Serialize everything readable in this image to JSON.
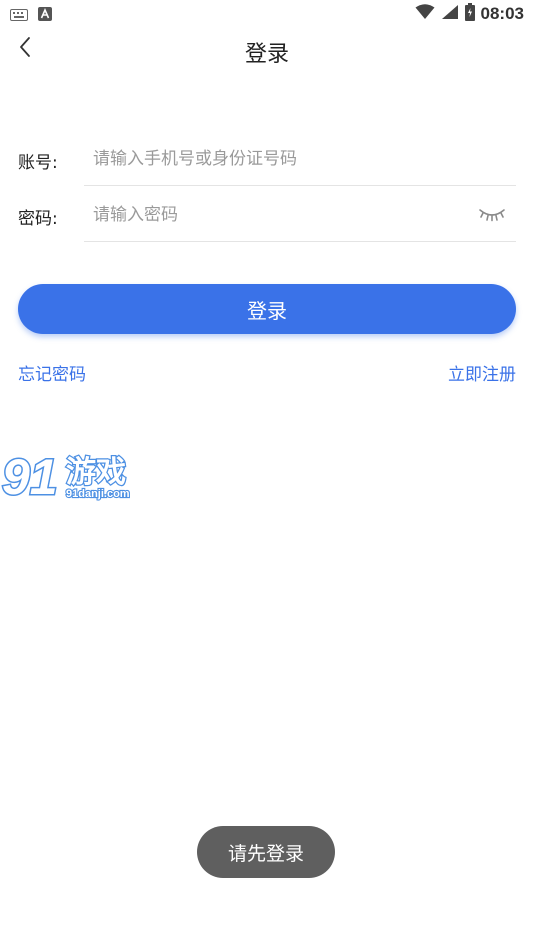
{
  "status_bar": {
    "time": "08:03",
    "notification_icons": [
      "keyboard-icon",
      "font-a-icon"
    ],
    "indicator_icons": [
      "wifi-icon",
      "signal-icon",
      "battery-icon"
    ]
  },
  "header": {
    "back_icon": "chevron-left-icon",
    "title": "登录"
  },
  "form": {
    "account": {
      "label": "账号:",
      "value": "",
      "placeholder": "请输入手机号或身份证号码"
    },
    "password": {
      "label": "密码:",
      "value": "",
      "placeholder": "请输入密码",
      "toggle_icon": "eye-closed-icon"
    },
    "login_label": "登录"
  },
  "links": {
    "forgot_password": "忘记密码",
    "register": "立即注册"
  },
  "watermark": {
    "brand": "游戏",
    "number": "91",
    "url": "91danji.com"
  },
  "toast": {
    "message": "请先登录"
  },
  "colors": {
    "accent": "#3a72e8",
    "toast_bg": "#5f5f5f",
    "divider": "#e4e4e4",
    "placeholder": "#9a9a9a"
  }
}
